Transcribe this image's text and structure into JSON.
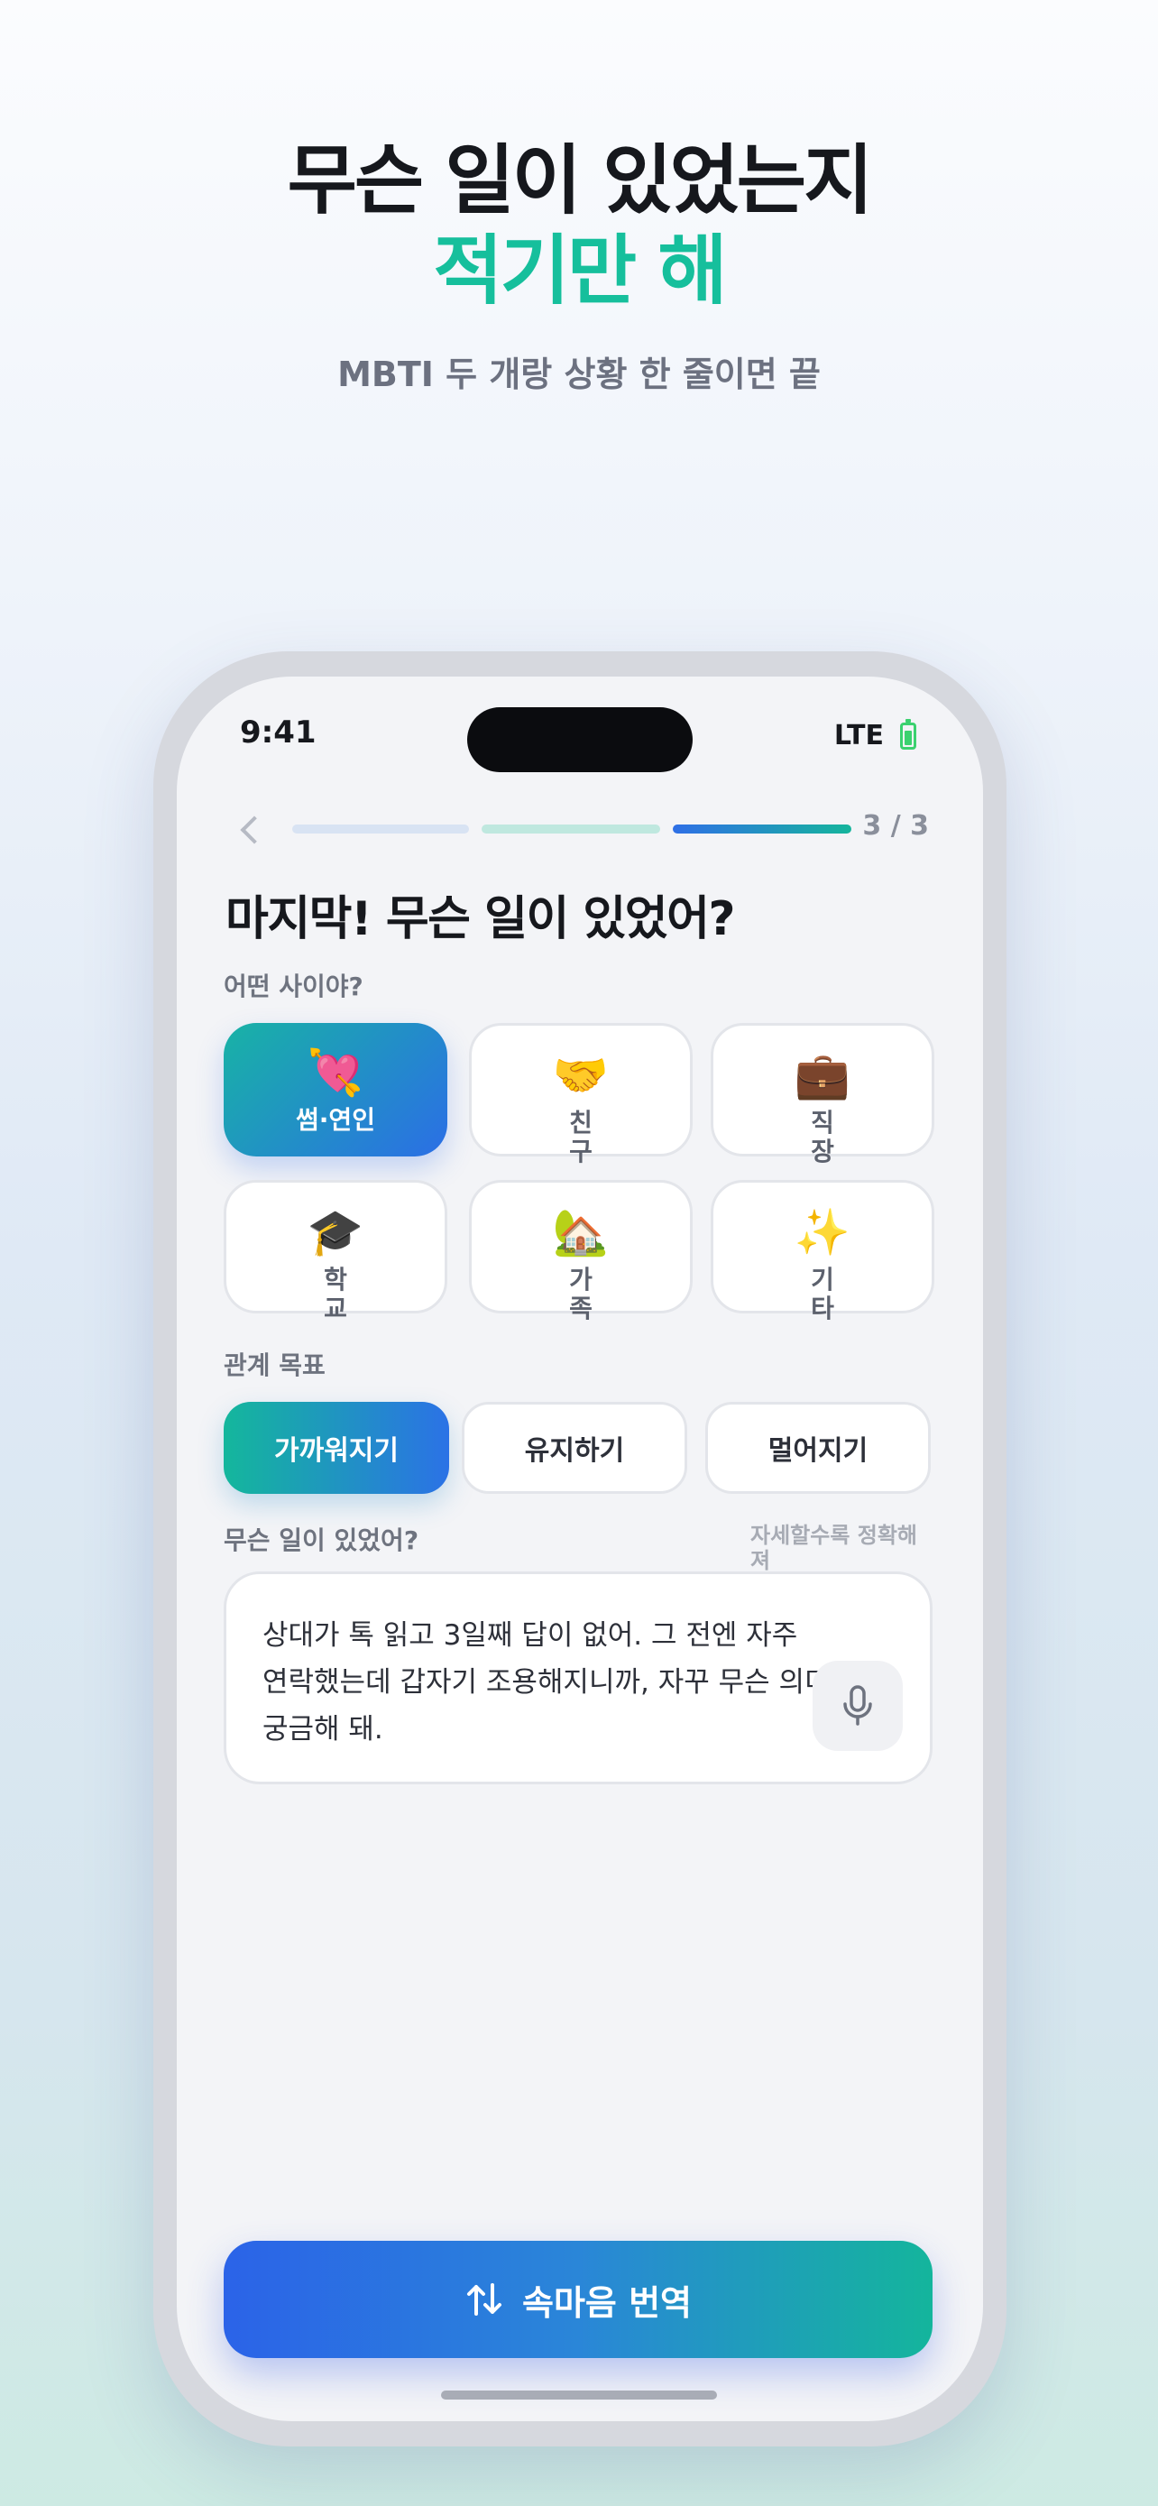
{
  "hero": {
    "line1": "무슨 일이 있었는지",
    "line2": "적기만 해",
    "subtitle": "MBTI 두 개랑 상황 한 줄이면 끝"
  },
  "status_bar": {
    "time": "9:41",
    "network": "LTE",
    "battery_icon": "battery-icon"
  },
  "progress": {
    "step_label": "3 / 3",
    "current": 3,
    "total": 3
  },
  "screen": {
    "title": "마지막! 무슨 일이 있었어?"
  },
  "relationship": {
    "label": "어떤 사이야?",
    "selected": "썸·연인",
    "options": [
      {
        "icon": "💘",
        "label": "썸·연인"
      },
      {
        "icon": "🤝",
        "label": "친구"
      },
      {
        "icon": "💼",
        "label": "직장"
      },
      {
        "icon": "🎓",
        "label": "학교"
      },
      {
        "icon": "🏡",
        "label": "가족"
      },
      {
        "icon": "✨",
        "label": "기타"
      }
    ]
  },
  "goal": {
    "label": "관계 목표",
    "selected": "가까워지기",
    "options": [
      "가까워지기",
      "유지하기",
      "멀어지기"
    ]
  },
  "situation": {
    "label": "무슨 일이 있었어?",
    "hint": "자세할수록 정확해져",
    "value": "상대가 톡 읽고 3일째 답이 없어. 그 전엔 자주 연락했는데 갑자기 조용해지니까, 자꾸 무슨 의미인지 궁금해 돼.",
    "mic_icon": "microphone-icon"
  },
  "cta": {
    "label": "속마음 번역",
    "icon": "swap-vertical-icon"
  },
  "colors": {
    "accent_green": "#16bf9c",
    "accent_blue": "#2b6ee6"
  }
}
